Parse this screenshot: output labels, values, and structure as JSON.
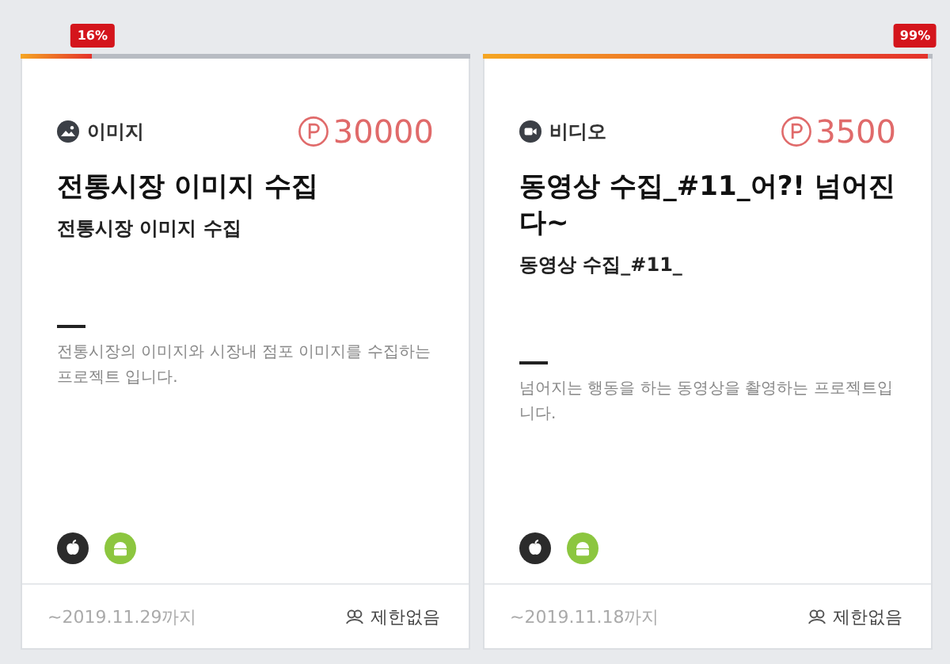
{
  "cards": [
    {
      "progress": {
        "label": "16%",
        "level": 0.16
      },
      "category": {
        "kind": "image",
        "label": "이미지"
      },
      "points": "30000",
      "title": "전통시장 이미지 수집",
      "subtitle": "전통시장 이미지 수집",
      "description": "전통시장의 이미지와 시장내 점포 이미지를 수집하는 프로젝트 입니다.",
      "platforms": [
        {
          "kind": "apple"
        },
        {
          "kind": "android"
        }
      ],
      "deadline": "~2019.11.29까지",
      "limit": "제한없음"
    },
    {
      "progress": {
        "label": "99%",
        "level": 0.99
      },
      "category": {
        "kind": "video",
        "label": "비디오"
      },
      "points": "3500",
      "title": "동영상 수집_#11_어?! 넘어진다~",
      "subtitle": "동영상 수집_#11_",
      "description": "넘어지는 행동을 하는 동영상을 촬영하는 프로젝트입니다.",
      "platforms": [
        {
          "kind": "apple"
        },
        {
          "kind": "android"
        }
      ],
      "deadline": "~2019.11.18까지",
      "limit": "제한없음"
    }
  ]
}
